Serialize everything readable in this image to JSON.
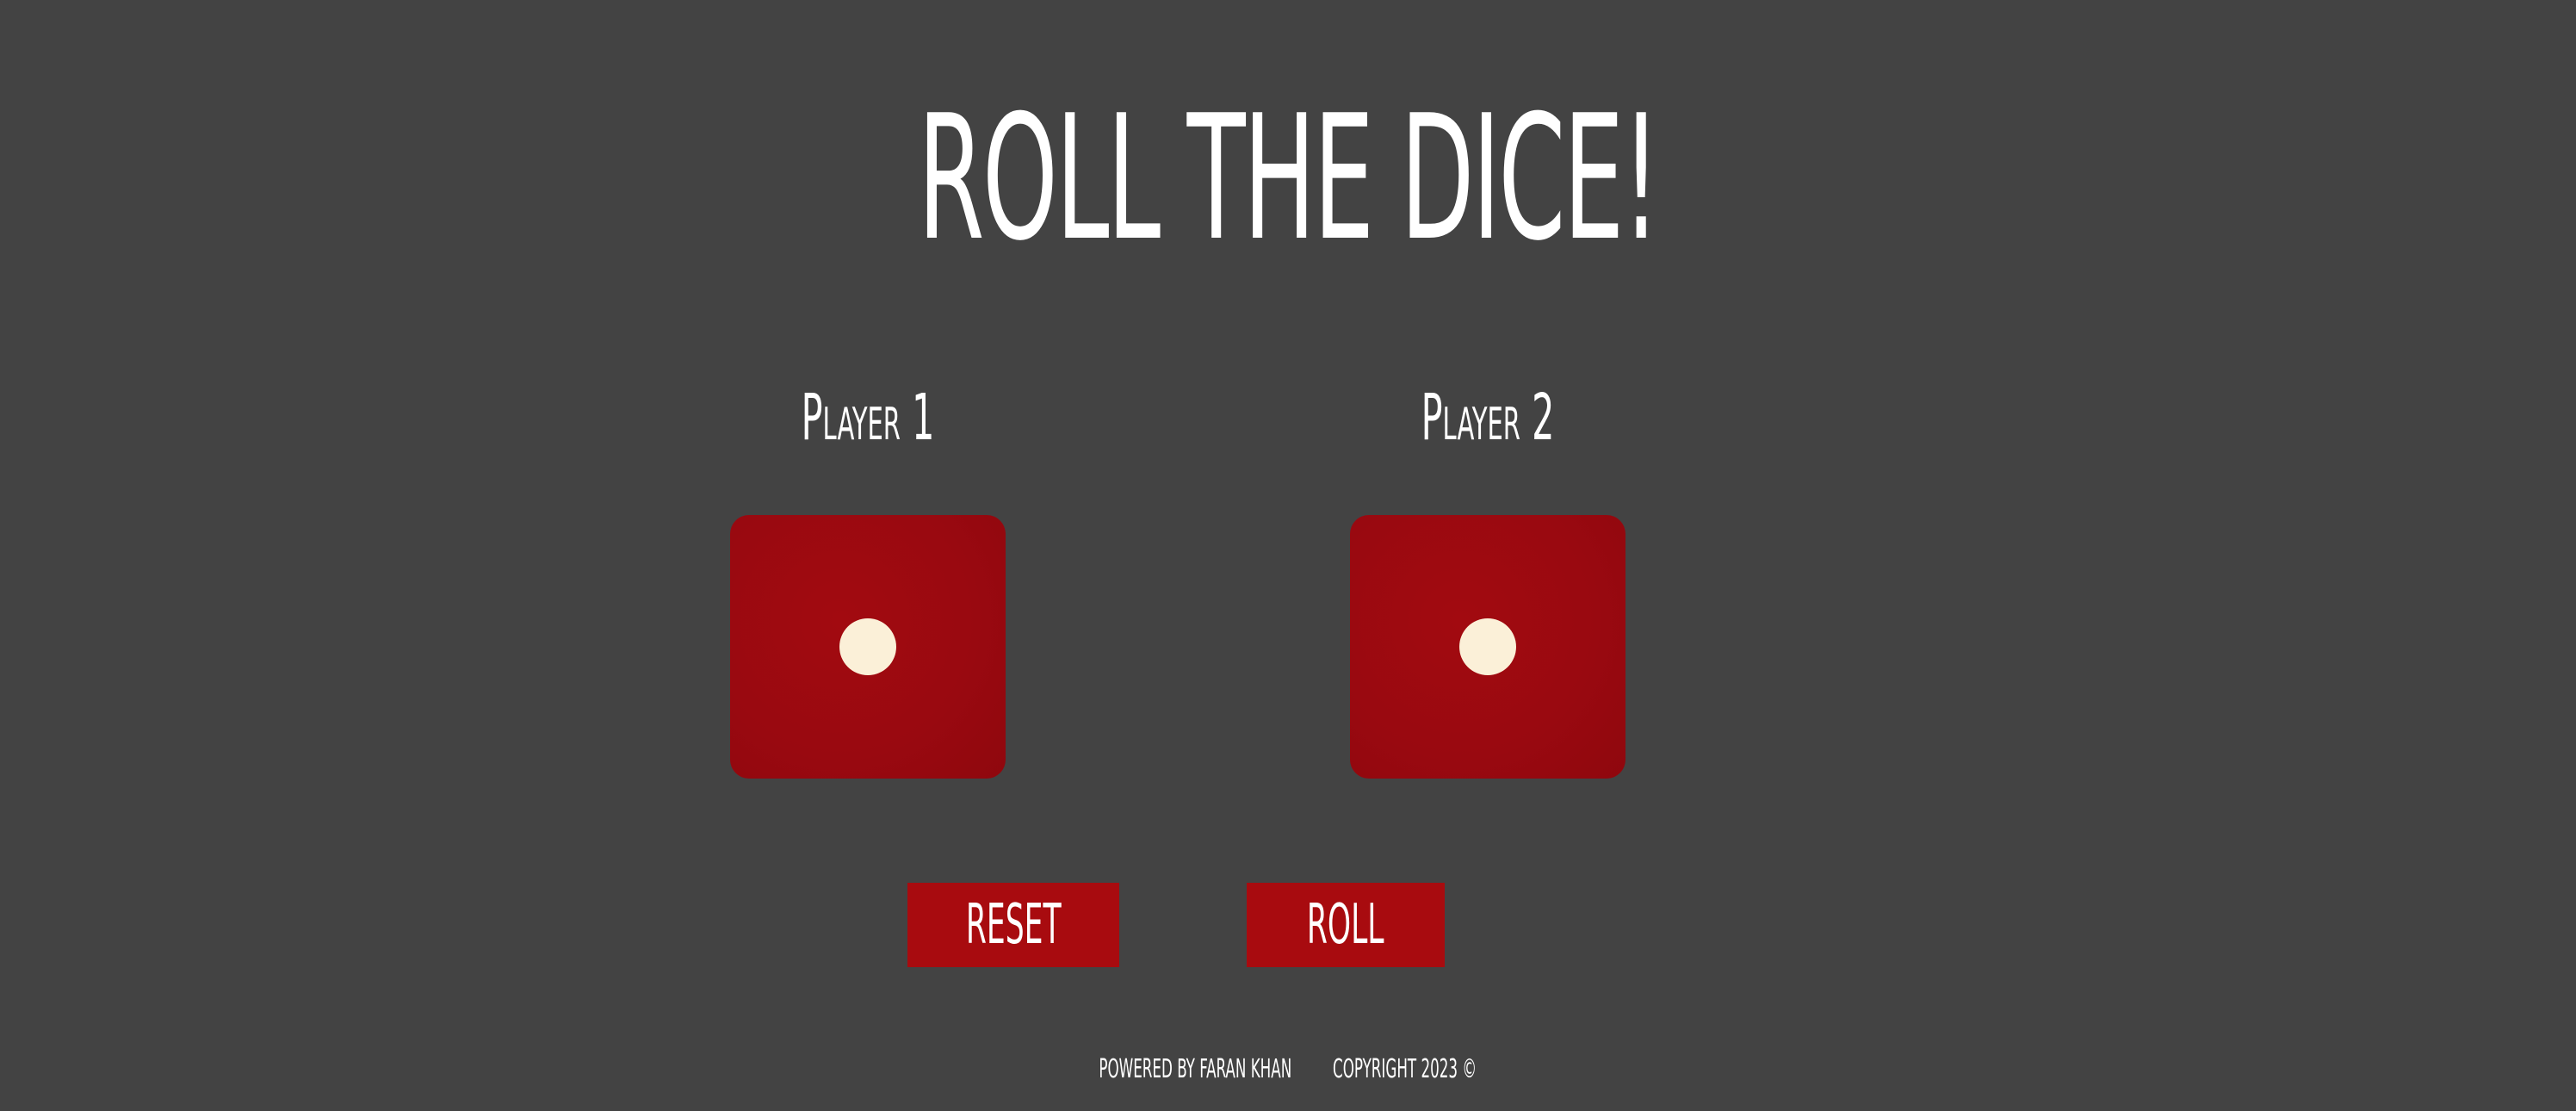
{
  "page": {
    "title": "ROLL THE DICE!"
  },
  "players": [
    {
      "label": "Player 1",
      "die_value": 1
    },
    {
      "label": "Player 2",
      "die_value": 1
    }
  ],
  "buttons": {
    "reset_label": "RESET",
    "roll_label": "ROLL"
  },
  "footer": {
    "powered_by": "POWERED BY FARAN KHAN",
    "copyright": "COPYRIGHT 2023 ©"
  },
  "colors": {
    "background": "#434343",
    "die": "#9b0a10",
    "pip": "#fbf0d8",
    "button": "#a80b0f",
    "text": "#ffffff"
  }
}
